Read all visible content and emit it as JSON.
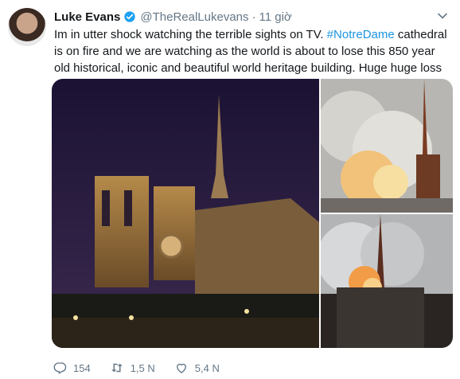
{
  "tweet": {
    "user": {
      "name": "Luke Evans",
      "handle": "@TheRealLukevans",
      "verified": true
    },
    "time_separator": "·",
    "time": "11 giờ",
    "text_before": "Im in utter shock watching the terrible sights on TV. ",
    "hashtag": "#NotreDame",
    "text_after": " cathedral is on fire and we are watching as the world is about to lose this 850 year old historical, iconic and beautiful world heritage building. Huge huge loss",
    "media": [
      {
        "name": "notre-dame-night-photo"
      },
      {
        "name": "notre-dame-fire-smoke-photo"
      },
      {
        "name": "notre-dame-spire-fire-photo"
      }
    ],
    "actions": {
      "reply_icon": "reply-icon",
      "reply_count": "154",
      "retweet_icon": "retweet-icon",
      "retweet_count": "1,5 N",
      "like_icon": "heart-icon",
      "like_count": "5,4 N"
    },
    "colors": {
      "hashtag": "#1b95e0",
      "verified": "#1da1f2",
      "muted": "#657786"
    }
  }
}
